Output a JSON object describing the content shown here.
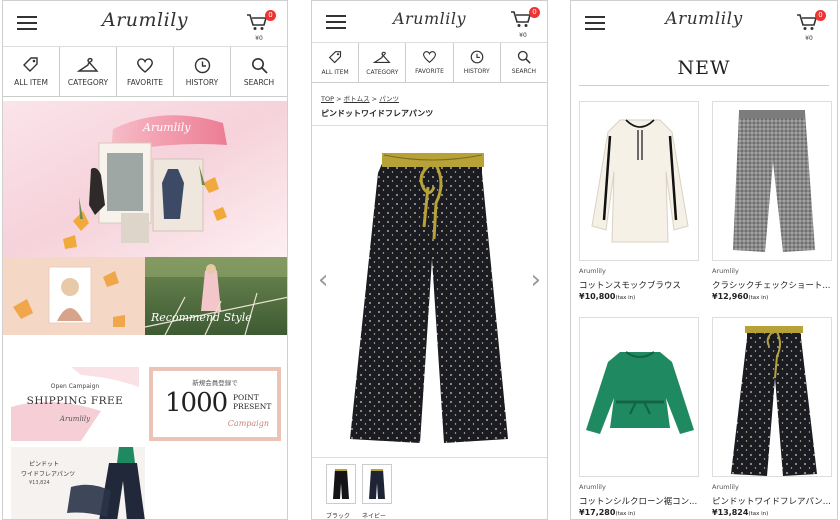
{
  "brand": "Arumlily",
  "header": {
    "cart_amount": "¥0",
    "cart_badge": "0"
  },
  "nav": [
    {
      "label": "ALL ITEM",
      "icon": "tag-icon"
    },
    {
      "label": "CATEGORY",
      "icon": "hanger-icon"
    },
    {
      "label": "FAVORITE",
      "icon": "heart-icon"
    },
    {
      "label": "HISTORY",
      "icon": "clock-icon"
    },
    {
      "label": "SEARCH",
      "icon": "search-icon"
    }
  ],
  "home": {
    "hero_logo": "Arumlily",
    "recommend_text": "Recommend Style",
    "shipping_banner": {
      "small": "Open Campaign",
      "main": "SHIPPING FREE",
      "sign": "Arumlily"
    },
    "point_banner": {
      "top": "新規会員登録で",
      "number": "1000",
      "point": "POINT",
      "present": "PRESENT",
      "sub": "Campaign"
    },
    "pants_banner": {
      "line1": "ピンドット",
      "line2": "ワイドフレアパンツ",
      "price": "¥13,824"
    }
  },
  "product": {
    "breadcrumb": [
      "TOP",
      "ボトムス",
      "パンツ"
    ],
    "title": "ピンドットワイドフレアパンツ",
    "prev_icon": "chevron-left-icon",
    "next_icon": "chevron-right-icon",
    "colors": [
      "ブラック",
      "ネイビー"
    ]
  },
  "new_items": {
    "title": "NEW",
    "items": [
      {
        "brand": "Arumlily",
        "name": "コットンスモックブラウス",
        "price": "¥10,800",
        "tax": "(tax in)"
      },
      {
        "brand": "Arumlily",
        "name": "クラシックチェックショート...",
        "price": "¥12,960",
        "tax": "(tax in)"
      },
      {
        "brand": "Arumlily",
        "name": "コットンシルクローン裾コン...",
        "price": "¥17,280",
        "tax": "(tax in)"
      },
      {
        "brand": "Arumlily",
        "name": "ピンドットワイドフレアパン...",
        "price": "¥13,824",
        "tax": "(tax in)"
      }
    ]
  },
  "colors": {
    "accent_red": "#e33333",
    "hero_pink": "#f2b7c1",
    "mustard": "#b8a032",
    "pants_black": "#1c1c22",
    "blouse_green": "#1f8a62"
  }
}
